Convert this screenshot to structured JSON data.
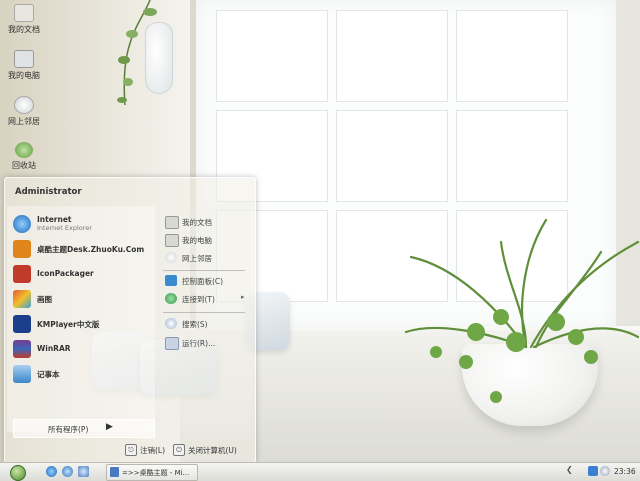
{
  "desktop_icons": [
    {
      "label": "我的文档",
      "icon": "folder-icon"
    },
    {
      "label": "我的电脑",
      "icon": "computer-icon"
    },
    {
      "label": "网上邻居",
      "icon": "network-icon"
    },
    {
      "label": "回收站",
      "icon": "recycle-bin-icon"
    }
  ],
  "start_menu": {
    "user": "Administrator",
    "programs": [
      {
        "name": "Internet",
        "sub": "Internet Explorer",
        "icon": "internet-explorer-icon",
        "color": "#2a7fd4"
      },
      {
        "name": "桌酷主题Desk.ZhuoKu.Com",
        "sub": "",
        "icon": "theme-icon",
        "color": "#e0851c"
      },
      {
        "name": "IconPackager",
        "sub": "",
        "icon": "iconpackager-icon",
        "color": "#c23a2a"
      },
      {
        "name": "画图",
        "sub": "",
        "icon": "paint-icon",
        "color": "#d9a02a"
      },
      {
        "name": "KMPlayer中文版",
        "sub": "",
        "icon": "kmplayer-icon",
        "color": "#1b3f8a"
      },
      {
        "name": "WinRAR",
        "sub": "",
        "icon": "winrar-icon",
        "color": "#7a3b8f"
      },
      {
        "name": "记事本",
        "sub": "",
        "icon": "notepad-icon",
        "color": "#3b86c9"
      }
    ],
    "all_programs": "所有程序(P)",
    "right_items": [
      {
        "label": "我的文档",
        "icon": "documents-icon",
        "color": "#d9d9d4",
        "arrow": ""
      },
      {
        "label": "我的电脑",
        "icon": "computer-icon",
        "color": "#d9d9d4",
        "arrow": ""
      },
      {
        "label": "网上邻居",
        "icon": "network-icon",
        "color": "#e8e8e8",
        "arrow": ""
      },
      {
        "label": "控制面板(C)",
        "icon": "control-panel-icon",
        "color": "#3a8ad0",
        "arrow": ""
      },
      {
        "label": "连接到(T)",
        "icon": "connect-icon",
        "color": "#2f9a4a",
        "arrow": "▸"
      },
      {
        "label": "搜索(S)",
        "icon": "search-icon",
        "color": "#cfd8e6",
        "arrow": ""
      },
      {
        "label": "运行(R)...",
        "icon": "run-icon",
        "color": "#c8d3e3",
        "arrow": ""
      }
    ],
    "logoff": "注销(L)",
    "shutdown": "关闭计算机(U)"
  },
  "taskbar": {
    "task_label": "=>>桌酷主题 - Mi...",
    "clock": "23:36",
    "tray_arrow": "❮"
  }
}
